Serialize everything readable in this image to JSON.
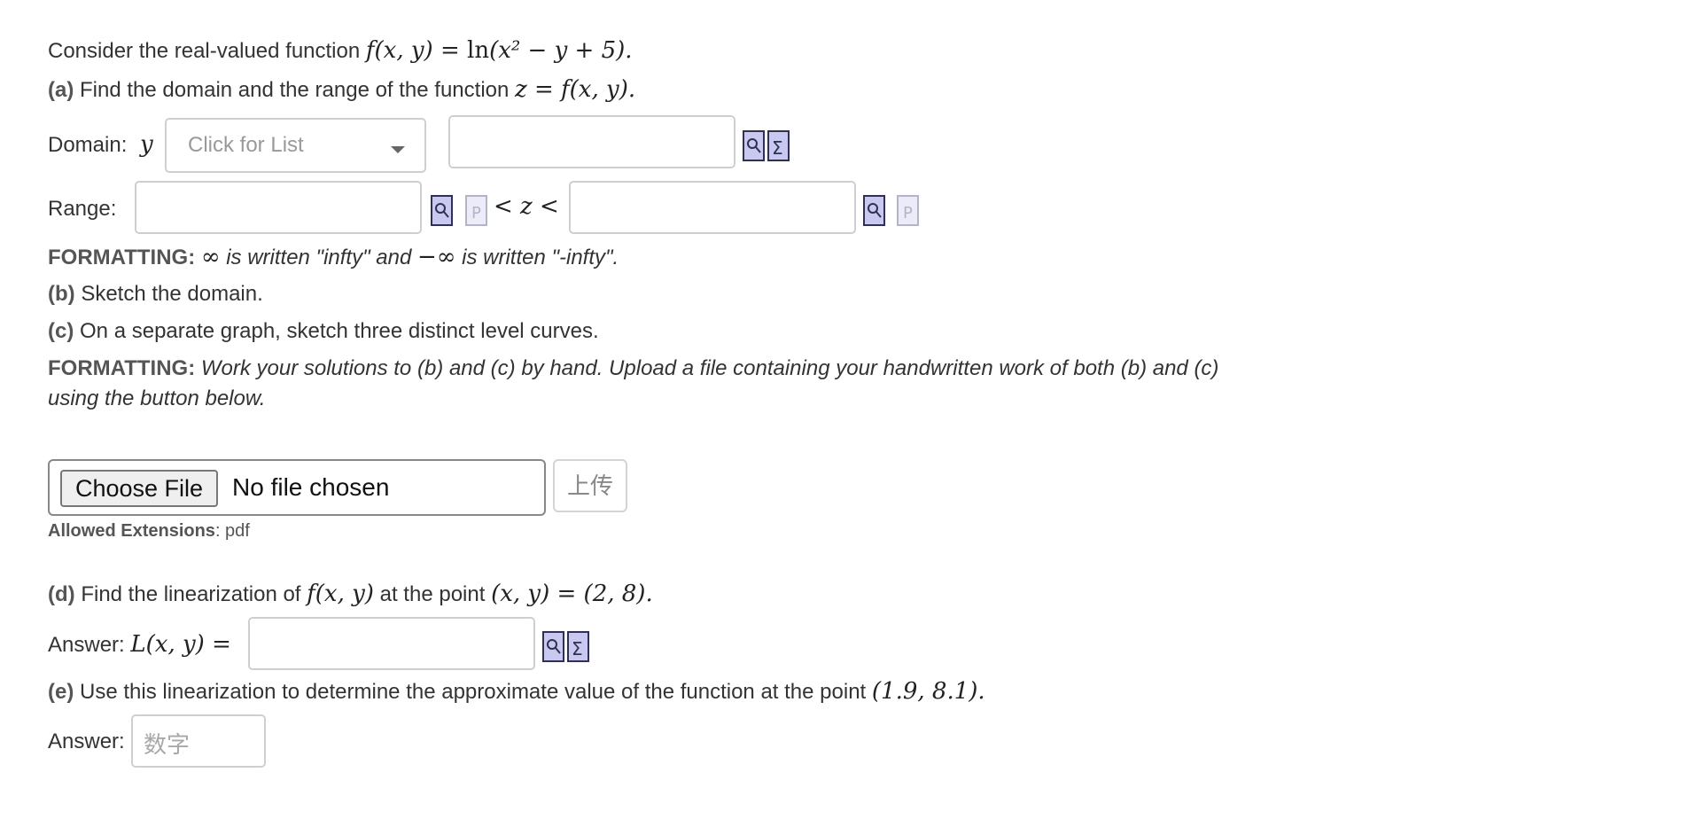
{
  "intro": {
    "text": "Consider the real-valued function",
    "math_lhs": "f(x, y) = ",
    "math_ln": "ln",
    "math_arg": "(x² − y + 5).",
    "period": ""
  },
  "part_a": {
    "tag": "(a)",
    "text": "Find the domain and the range of the function",
    "math": "z = f(x, y)."
  },
  "domain": {
    "label": "Domain:",
    "var": "y",
    "select_placeholder": "Click for List",
    "input_value": ""
  },
  "range": {
    "label": "Range:",
    "mid": "< z <",
    "left_value": "",
    "right_value": ""
  },
  "formatting_1": {
    "tag": "FORMATTING:",
    "inf": "∞",
    "text1": "is written \"infty\" and",
    "neginf": "−∞",
    "text2": "is written \"-infty\"."
  },
  "part_b": {
    "tag": "(b)",
    "text": "Sketch the domain."
  },
  "part_c": {
    "tag": "(c)",
    "text": "On a separate graph, sketch three distinct level curves."
  },
  "formatting_2": {
    "tag": "FORMATTING:",
    "line1": "Work your solutions to (b) and (c) by hand. Upload a file containing your handwritten work of both (b) and (c)",
    "line2": "using the button below."
  },
  "upload": {
    "choose_label": "Choose File",
    "status": "No file chosen",
    "upload_label": "上传",
    "ext_label": "Allowed Extensions",
    "ext_value": ": pdf"
  },
  "part_d": {
    "tag": "(d)",
    "text1": "Find the linearization of",
    "math1": "f(x, y)",
    "text2": "at the point",
    "math2": "(x, y) = (2, 8)."
  },
  "answer_d": {
    "label": "Answer:",
    "math": "L(x, y) =",
    "value": ""
  },
  "part_e": {
    "tag": "(e)",
    "text": "Use this linearization to determine the approximate value of the function at the point",
    "math": "(1.9, 8.1)."
  },
  "answer_e": {
    "label": "Answer:",
    "placeholder": "数字"
  },
  "icons": {
    "preview": "magnifier-document-icon",
    "equation": "sigma-document-icon",
    "plain": "p-document-icon"
  }
}
